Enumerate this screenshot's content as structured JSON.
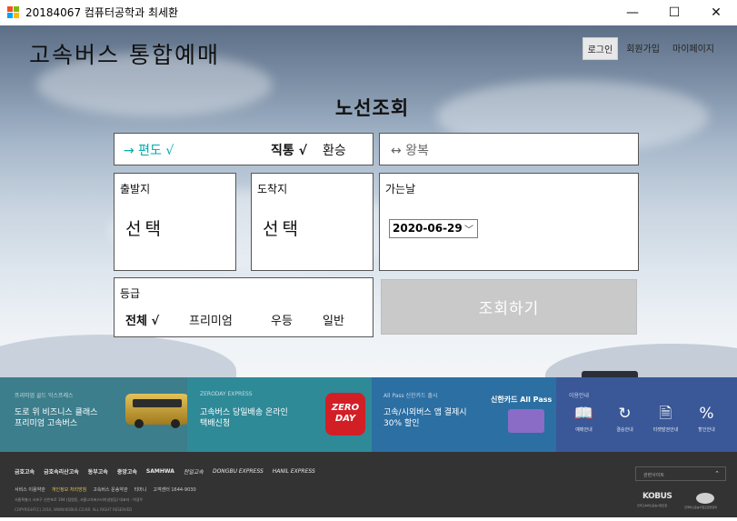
{
  "window": {
    "title": "20184067 컴퓨터공학과 최세환",
    "minimize": "—",
    "maximize": "☐",
    "close": "✕"
  },
  "header": {
    "brand": "고속버스 통합예매",
    "links": [
      "로그인",
      "회원가입",
      "마이페이지"
    ]
  },
  "section_title": "노선조회",
  "trip": {
    "one_way": "→ 편도 √",
    "direct": "직통 √",
    "transfer": "환승",
    "round_trip": "↔ 왕복"
  },
  "departure": {
    "label": "출발지",
    "value": "선택"
  },
  "arrival": {
    "label": "도착지",
    "value": "선택"
  },
  "date": {
    "label": "가는날",
    "value": "2020-06-29",
    "chevron": "﹀"
  },
  "grade": {
    "label": "등급",
    "options": [
      "전체 √",
      "프리미엄",
      "우등",
      "일반"
    ]
  },
  "search_button": "조회하기",
  "promos": [
    {
      "tag": "프리미엄 골드 익스프레스",
      "text": "도로 위 비즈니스 클래스\n프리미엄 고속버스",
      "color": "#3c7e8c"
    },
    {
      "tag": "ZERODAY EXPRESS",
      "text": "고속버스 당일배송 온라인\n택배신청",
      "color": "#2f8a98"
    },
    {
      "tag": "All Pass 신한카드 출시",
      "text": "고속/시외버스 앱 결제시\n30% 할인",
      "card_title": "신한카드 All Pass",
      "color": "#2c6fa3"
    },
    {
      "tag": "이용안내",
      "color": "#3a5898"
    }
  ],
  "zero_day_logo": "ZERO\nDAY",
  "guides": [
    {
      "icon": "book-icon",
      "glyph": "📖",
      "label": "예매안내"
    },
    {
      "icon": "refresh-icon",
      "glyph": "↻",
      "label": "결승안내"
    },
    {
      "icon": "receipt-icon",
      "glyph": "🗎",
      "label": "티켓발권안내"
    },
    {
      "icon": "percent-icon",
      "glyph": "%",
      "label": "할인안내"
    }
  ],
  "footer": {
    "logos": [
      "금호고속",
      "금호속리산고속",
      "동부고속",
      "중앙고속",
      "SAMHWA",
      "천일고속",
      "DONGBU EXPRESS",
      "HANIL EXPRESS"
    ],
    "links": [
      "서비스 이용약관",
      "개인정보 처리방침",
      "고속버스 운송약관",
      "티머니",
      "고객센터 1644-9030"
    ],
    "address": "서울특별시 서초구 신반포로 194 (잠원동, 서울고속버스터미널빌딩) 대표자 : 박광우",
    "copyright": "COPYRIGHT(C) 2016, WWW.KOBUS.CO.KR. ALL RIGHT RESERVED",
    "family_site": "관련사이트",
    "family_chevron": "⌃",
    "kobus": "KOBUS",
    "kobus_sub": "전국고속버스운송사업조합",
    "assoc_sub": "한국버스운송사업조합연합회"
  }
}
